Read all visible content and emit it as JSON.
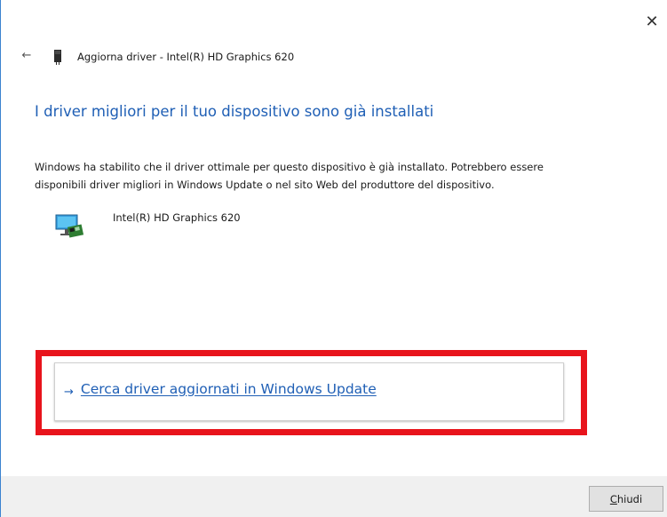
{
  "window": {
    "close_glyph": "✕",
    "back_glyph": "←"
  },
  "header": {
    "title": "Aggiorna driver - Intel(R) HD Graphics 620",
    "icon": "graphics-card-icon"
  },
  "main": {
    "heading": "I driver migliori per il tuo dispositivo sono già installati",
    "description_line1": "Windows ha stabilito che il driver ottimale per questo dispositivo è già installato. Potrebbero essere",
    "description_line2": "disponibili driver migliori in Windows Update o nel sito Web del produttore del dispositivo.",
    "device_name": "Intel(R) HD Graphics 620",
    "device_icon": "display-adapter-icon"
  },
  "action": {
    "arrow": "→",
    "link_text": "Cerca driver aggiornati in Windows Update",
    "highlight_color": "#e8141c"
  },
  "footer": {
    "close_button_mnemonic": "C",
    "close_button_rest": "hiudi"
  },
  "colors": {
    "accent": "#1f5fb5",
    "footer_bg": "#f0f0f0"
  }
}
